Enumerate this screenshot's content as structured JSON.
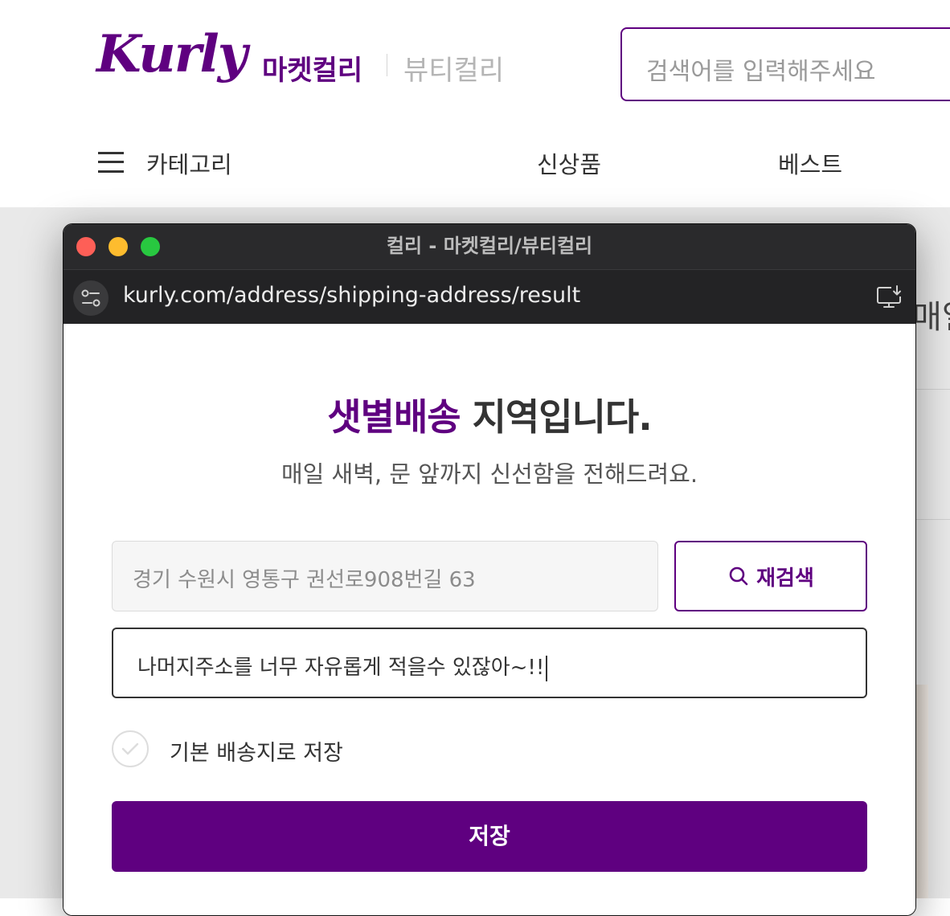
{
  "site": {
    "logo": "Kurly",
    "tabs": [
      "마켓컬리",
      "뷰티컬리"
    ],
    "search_placeholder": "검색어를 입력해주세요",
    "nav": {
      "category": "카테고리",
      "new_products": "신상품",
      "best": "베스트"
    },
    "background_partial_text": "매일"
  },
  "popup": {
    "window_title": "컬리 - 마켓컬리/뷰티컬리",
    "url": "kurly.com/address/shipping-address/result",
    "heading_highlight": "샛별배송",
    "heading_rest": " 지역입니다.",
    "subheading": "매일 새벽, 문 앞까지 신선함을 전해드려요.",
    "address_value": "경기 수원시 영통구 권선로908번길 63",
    "research_label": "재검색",
    "detail_value": "나머지주소를 너무 자유롭게 적을수 있잖아~!!",
    "default_checkbox_label": "기본 배송지로 저장",
    "default_checked": false,
    "save_label": "저장"
  },
  "colors": {
    "brand_purple": "#5f0080",
    "traffic_close": "#fe5f57",
    "traffic_minimize": "#febc2e",
    "traffic_maximize": "#28c840"
  }
}
